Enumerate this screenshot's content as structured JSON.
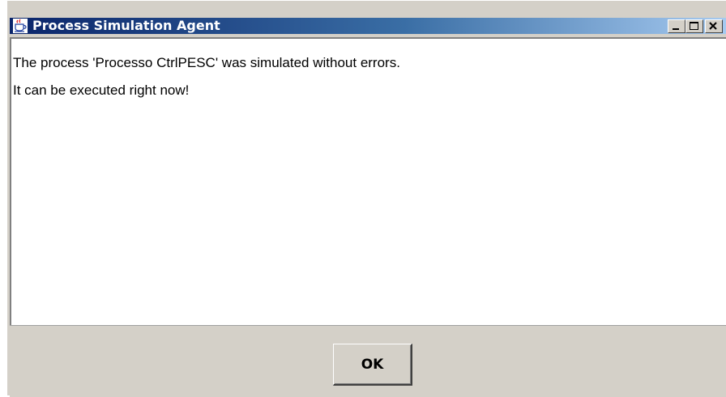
{
  "window": {
    "title": "Process Simulation Agent",
    "icon": "java-cup-icon"
  },
  "title_controls": {
    "minimize_icon": "minimize-icon",
    "maximize_icon": "maximize-icon",
    "close_icon": "close-icon"
  },
  "message": {
    "line1": "The process 'Processo CtrlPESC' was simulated without errors.",
    "line2": "It can be executed right now!"
  },
  "footer": {
    "ok_label": "OK"
  },
  "colors": {
    "titlebar_start": "#0a246a",
    "titlebar_end": "#a6caf0",
    "dialog_bg": "#d4d0c8"
  }
}
